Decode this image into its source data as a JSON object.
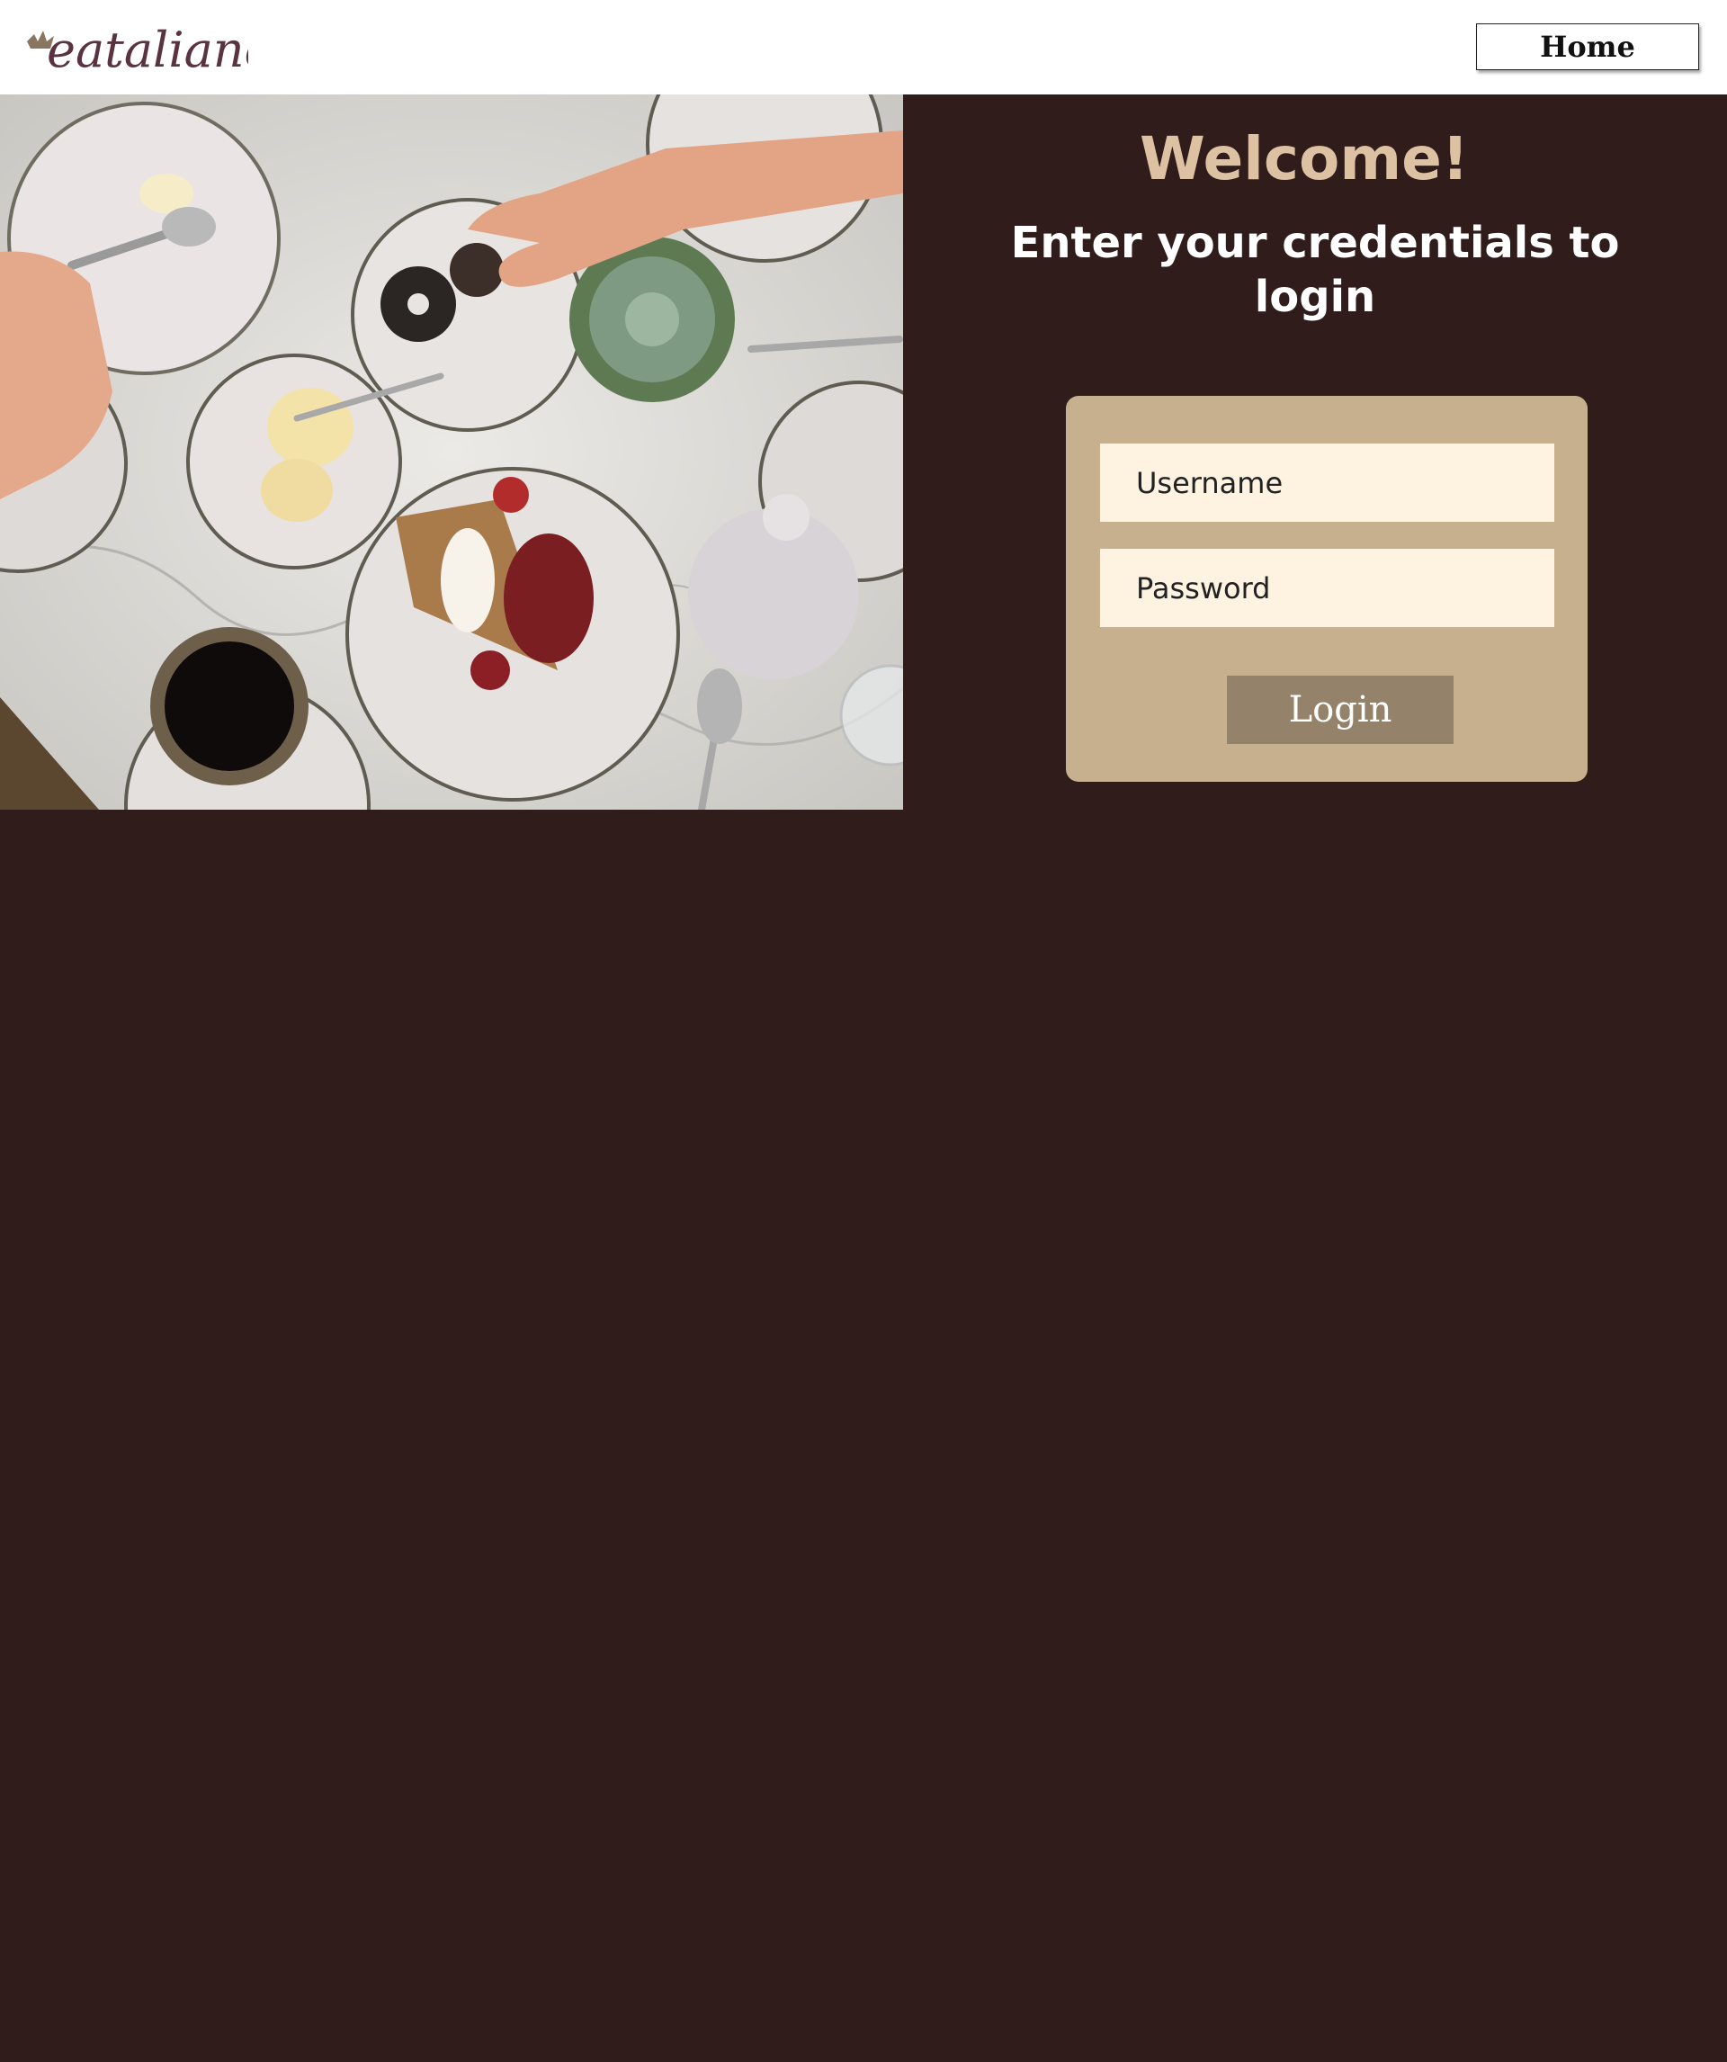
{
  "header": {
    "logo_text": "eataliano",
    "home_label": "Home"
  },
  "hero": {
    "image_name": "table-with-desserts-and-coffee"
  },
  "main": {
    "welcome": "Welcome!",
    "subtitle": "Enter your credentials to login"
  },
  "login_form": {
    "username_placeholder": "Username",
    "password_placeholder": "Password",
    "submit_label": "Login"
  },
  "colors": {
    "background": "#311c1c",
    "accent": "#dcc2a2",
    "card": "#c7b08d",
    "field": "#fdf3e0",
    "button": "#94826a"
  }
}
